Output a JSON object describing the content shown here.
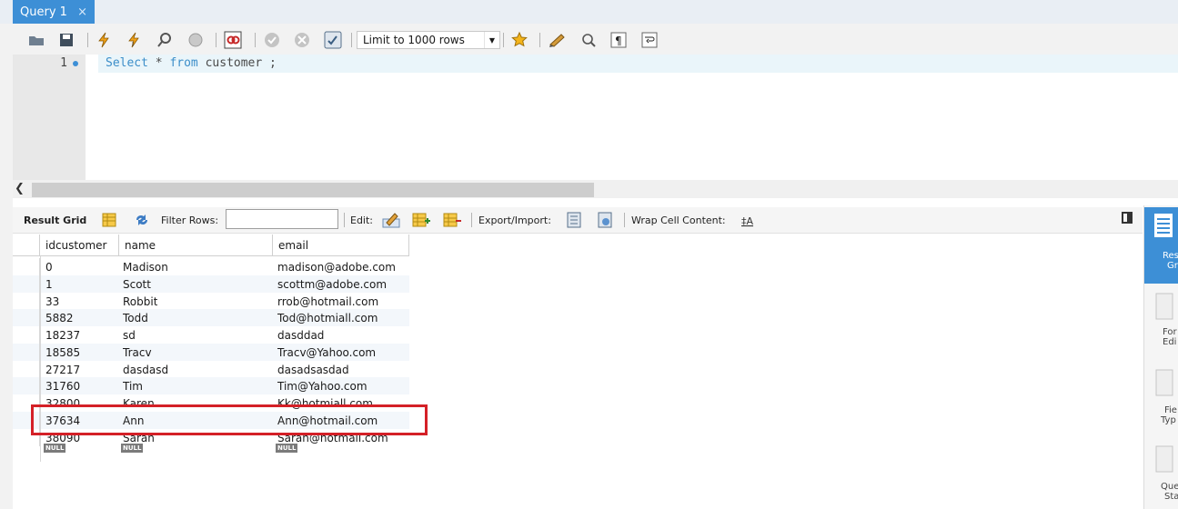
{
  "tab": {
    "label": "Query 1",
    "close": "×"
  },
  "toolbar": {
    "limit_label": "Limit to 1000 rows",
    "icons": [
      "open-folder-icon",
      "save-icon",
      "execute-lightning-icon",
      "execute-current-icon",
      "explain-magnifier-icon",
      "stop-icon",
      "toggle-error-icon",
      "commit-check-icon",
      "rollback-x-icon",
      "autocommit-icon",
      "star-snippet-icon",
      "beautify-brush-icon",
      "find-magnifier-icon",
      "invisible-chars-icon",
      "wrap-lines-icon"
    ]
  },
  "editor": {
    "line_number": "1",
    "code_keyword1": "Select",
    "code_rest1": " * ",
    "code_keyword2": "from",
    "code_rest2": " customer ;"
  },
  "result_toolbar": {
    "result_grid": "Result Grid",
    "filter_rows": "Filter Rows:",
    "edit": "Edit:",
    "export_import": "Export/Import:",
    "wrap_cell": "Wrap Cell Content:"
  },
  "grid": {
    "columns": [
      "idcustomer",
      "name",
      "email"
    ],
    "rows": [
      [
        "0",
        "Madison",
        "madison@adobe.com"
      ],
      [
        "1",
        "Scott",
        "scottm@adobe.com"
      ],
      [
        "33",
        "Robbit",
        "rrob@hotmail.com"
      ],
      [
        "5882",
        "Todd",
        "Tod@hotmiall.com"
      ],
      [
        "18237",
        "sd",
        "dasddad"
      ],
      [
        "18585",
        "Tracv",
        "Tracv@Yahoo.com"
      ],
      [
        "27217",
        "dasdasd",
        "dasadsasdad"
      ],
      [
        "31760",
        "Tim",
        "Tim@Yahoo.com"
      ],
      [
        "32800",
        "Karen",
        "Kk@hotmiall.com"
      ],
      [
        "37634",
        "Ann",
        "Ann@hotmail.com"
      ],
      [
        "38090",
        "Sarah",
        "Sarah@hotmail.com"
      ]
    ],
    "null_label": "NULL"
  },
  "side_panel": {
    "result_grid": [
      "Res",
      "Gr"
    ],
    "form_editor": [
      "For",
      "Edi"
    ],
    "field_types": [
      "Fie",
      "Typ"
    ],
    "query_stats": [
      "Que",
      "Sta"
    ]
  },
  "colors": {
    "accent": "#3d8fd6",
    "highlight": "#d42027"
  }
}
